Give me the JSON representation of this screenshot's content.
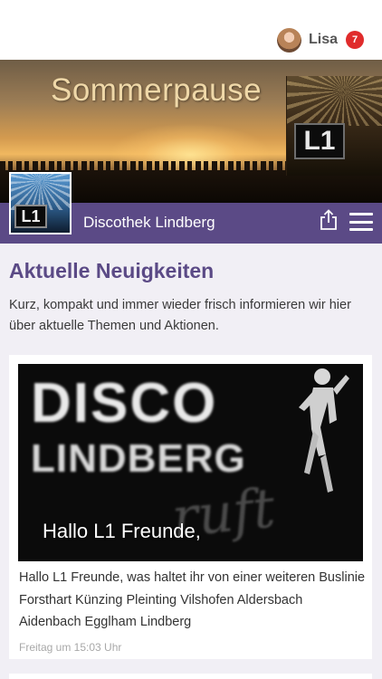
{
  "header": {
    "user_name": "Lisa",
    "notification_count": "7"
  },
  "hero": {
    "title": "Sommerpause",
    "logo_text": "L1"
  },
  "navbar": {
    "logo_text": "L1",
    "site_name": "Discothek Lindberg"
  },
  "main": {
    "section_title": "Aktuelle Neuigkeiten",
    "intro": "Kurz, kompakt und immer wieder frisch informieren wir hier über aktuelle Themen und Aktionen."
  },
  "news": [
    {
      "image_line1": "DISCO",
      "image_line2": "LINDBERG",
      "image_line3": "ruft",
      "image_caption": "Hallo L1 Freunde,",
      "text": "Hallo L1 Freunde, was haltet ihr von einer weiteren Buslinie Forsthart Künzing Pleinting Vilshofen Aldersbach Aidenbach Egglham Lindberg",
      "time": "Freitag um 15:03 Uhr"
    }
  ],
  "colors": {
    "accent": "#5b4a86",
    "badge": "#e02b2b",
    "background": "#f1eff5"
  },
  "icons": {
    "share": "share-icon",
    "menu": "hamburger-menu-icon"
  }
}
